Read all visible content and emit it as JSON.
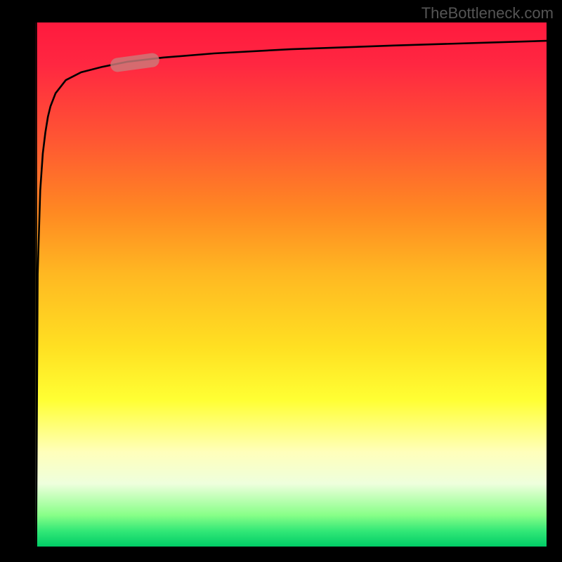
{
  "watermark": "TheBottleneck.com",
  "chart_data": {
    "type": "line",
    "title": "",
    "xlabel": "",
    "ylabel": "",
    "xlim": [
      0,
      100
    ],
    "ylim": [
      0,
      100
    ],
    "series": [
      {
        "name": "curve",
        "x": [
          0.2,
          0.5,
          1,
          1.5,
          2,
          2.5,
          3,
          4,
          6,
          9,
          13,
          18,
          25,
          35,
          50,
          70,
          90,
          100
        ],
        "values": [
          0,
          52,
          68,
          75,
          79,
          82,
          84,
          86.5,
          89,
          90.5,
          91.5,
          92.5,
          93.3,
          94.1,
          94.9,
          95.6,
          96.2,
          96.5
        ]
      },
      {
        "name": "vertical-edge",
        "x": [
          0.2,
          0.2
        ],
        "values": [
          0,
          100
        ]
      }
    ],
    "marker": {
      "x_range": [
        15,
        24
      ],
      "y_range": [
        91.8,
        93.0
      ]
    },
    "background_gradient": {
      "top": "#ff1a3e",
      "middle": "#ffff33",
      "bottom": "#00cc66"
    },
    "frame_color": "#000000"
  }
}
